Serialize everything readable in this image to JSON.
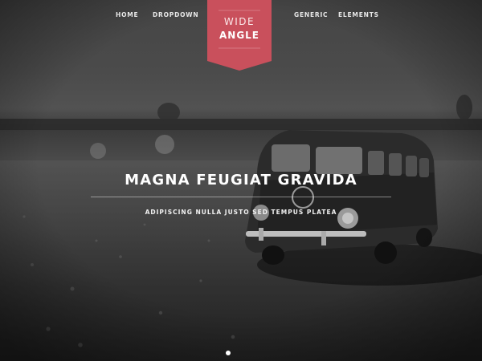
{
  "nav": {
    "items": [
      {
        "label": "HOME"
      },
      {
        "label": "DROPDOWN"
      },
      {
        "label": "GENERIC"
      },
      {
        "label": "ELEMENTS"
      }
    ]
  },
  "logo": {
    "line1": "WIDE",
    "line2": "ANGLE"
  },
  "hero": {
    "title": "MAGNA FEUGIAT GRAVIDA",
    "subtitle": "ADIPISCING NULLA JUSTO SED TEMPUS PLATEA"
  },
  "colors": {
    "accent": "#c9505c"
  }
}
